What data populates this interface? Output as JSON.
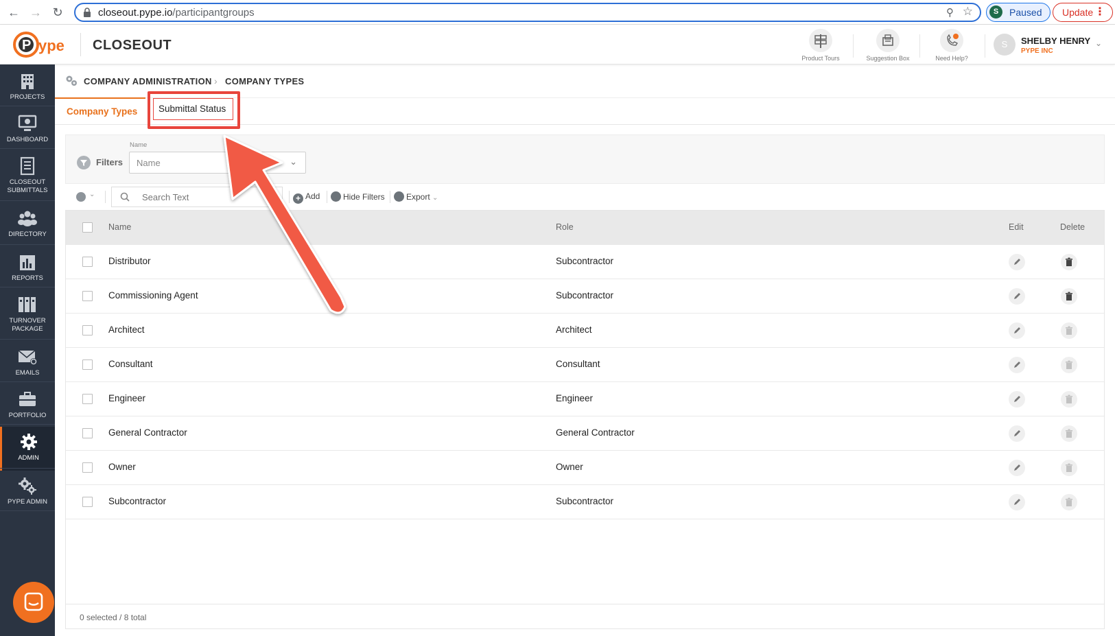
{
  "browser": {
    "url_host": "closeout.pype.io",
    "url_path": "/participantgroups",
    "profile_initial": "S",
    "profile_status": "Paused",
    "update_label": "Update"
  },
  "header": {
    "product": "CLOSEOUT",
    "product_tours": "Product Tours",
    "suggestion_box": "Suggestion Box",
    "need_help": "Need Help?",
    "user_initial": "S",
    "user_name": "SHELBY HENRY",
    "user_company": "PYPE INC"
  },
  "sidebar": {
    "items": [
      {
        "label": "PROJECTS"
      },
      {
        "label": "DASHBOARD"
      },
      {
        "label": "CLOSEOUT SUBMITTALS"
      },
      {
        "label": "DIRECTORY"
      },
      {
        "label": "REPORTS"
      },
      {
        "label": "TURNOVER PACKAGE"
      },
      {
        "label": "EMAILS"
      },
      {
        "label": "PORTFOLIO"
      },
      {
        "label": "ADMIN"
      },
      {
        "label": "PYPE ADMIN"
      }
    ]
  },
  "breadcrumb": {
    "parent": "COMPANY ADMINISTRATION",
    "current": "COMPANY TYPES"
  },
  "tabs": {
    "active": "Company Types",
    "second": "Submittal Status"
  },
  "filters": {
    "label": "Filters",
    "name_label": "Name",
    "name_placeholder": "Name"
  },
  "toolbar": {
    "search_placeholder": "Search Text",
    "add": "Add",
    "hide_filters": "Hide Filters",
    "export": "Export"
  },
  "table": {
    "headers": {
      "name": "Name",
      "role": "Role",
      "edit": "Edit",
      "delete": "Delete"
    },
    "rows": [
      {
        "name": "Distributor",
        "role": "Subcontractor"
      },
      {
        "name": "Commissioning Agent",
        "role": "Subcontractor"
      },
      {
        "name": "Architect",
        "role": "Architect"
      },
      {
        "name": "Consultant",
        "role": "Consultant"
      },
      {
        "name": "Engineer",
        "role": "Engineer"
      },
      {
        "name": "General Contractor",
        "role": "General Contractor"
      },
      {
        "name": "Owner",
        "role": "Owner"
      },
      {
        "name": "Subcontractor",
        "role": "Subcontractor"
      }
    ],
    "footer": "0 selected / 8 total"
  },
  "colors": {
    "accent": "#F07020",
    "sidebar_bg": "#2B3442",
    "highlight": "#E8453C"
  }
}
